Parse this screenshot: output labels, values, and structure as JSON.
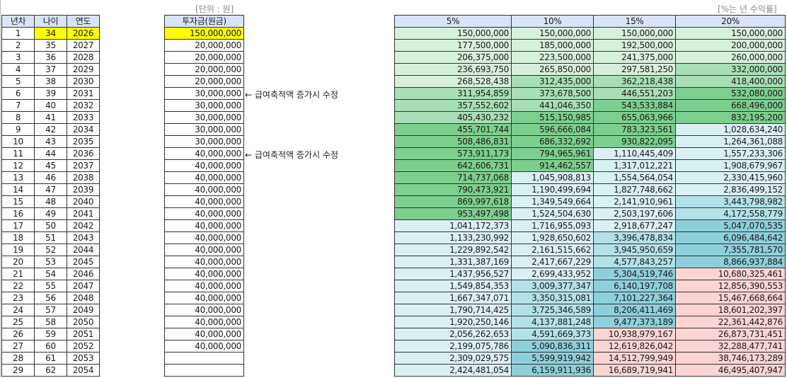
{
  "left_table": {
    "headers": [
      "년차",
      "나이",
      "연도"
    ],
    "ages": [
      "34",
      "35",
      "36",
      "37",
      "38",
      "39",
      "40",
      "41",
      "42",
      "43",
      "44",
      "45",
      "46",
      "47",
      "48",
      "49",
      "50",
      "51",
      "52",
      "53",
      "54",
      "55",
      "56",
      "57",
      "58",
      "59",
      "60",
      "61",
      "62"
    ],
    "years": [
      "2026",
      "2027",
      "2028",
      "2029",
      "2030",
      "2031",
      "2032",
      "2033",
      "2034",
      "2035",
      "2036",
      "2037",
      "2038",
      "2039",
      "2040",
      "2041",
      "2042",
      "2043",
      "2044",
      "2045",
      "2046",
      "2047",
      "2048",
      "2049",
      "2050",
      "2051",
      "2052",
      "2053",
      "2054"
    ]
  },
  "invest_table": {
    "unit_label": "[단위 : 원]",
    "header": "투자금(원금)",
    "values": [
      "150,000,000",
      "20,000,000",
      "20,000,000",
      "20,000,000",
      "20,000,000",
      "30,000,000",
      "30,000,000",
      "30,000,000",
      "30,000,000",
      "30,000,000",
      "40,000,000",
      "40,000,000",
      "40,000,000",
      "40,000,000",
      "40,000,000",
      "40,000,000",
      "40,000,000",
      "40,000,000",
      "40,000,000",
      "40,000,000",
      "40,000,000",
      "40,000,000",
      "40,000,000",
      "40,000,000",
      "40,000,000",
      "40,000,000",
      "40,000,000",
      "",
      ""
    ],
    "notes": [
      {
        "row": 6,
        "text": "← 급여축적액 증가시 수정"
      },
      {
        "row": 11,
        "text": "← 급여축적액 증가시 수정"
      }
    ]
  },
  "return_table": {
    "unit_label": "[%는 년 수익률]",
    "headers": [
      "5%",
      "10%",
      "15%",
      "20%"
    ],
    "rows": [
      [
        "150,000,000",
        "150,000,000",
        "150,000,000",
        "150,000,000"
      ],
      [
        "177,500,000",
        "185,000,000",
        "192,500,000",
        "200,000,000"
      ],
      [
        "206,375,000",
        "223,500,000",
        "241,375,000",
        "260,000,000"
      ],
      [
        "236,693,750",
        "265,850,000",
        "297,581,250",
        "332,000,000"
      ],
      [
        "268,528,438",
        "312,435,000",
        "362,218,438",
        "418,400,000"
      ],
      [
        "311,954,859",
        "373,678,500",
        "446,551,203",
        "532,080,000"
      ],
      [
        "357,552,602",
        "441,046,350",
        "543,533,884",
        "668,496,000"
      ],
      [
        "405,430,232",
        "515,150,985",
        "655,063,966",
        "832,195,200"
      ],
      [
        "455,701,744",
        "596,666,084",
        "783,323,561",
        "1,028,634,240"
      ],
      [
        "508,486,831",
        "686,332,692",
        "930,822,095",
        "1,264,361,088"
      ],
      [
        "573,911,173",
        "794,965,961",
        "1,110,445,409",
        "1,557,233,306"
      ],
      [
        "642,606,731",
        "914,462,557",
        "1,317,012,221",
        "1,908,679,967"
      ],
      [
        "714,737,068",
        "1,045,908,813",
        "1,554,564,054",
        "2,330,415,960"
      ],
      [
        "790,473,921",
        "1,190,499,694",
        "1,827,748,662",
        "2,836,499,152"
      ],
      [
        "869,997,618",
        "1,349,549,664",
        "2,141,910,961",
        "3,443,798,982"
      ],
      [
        "953,497,498",
        "1,524,504,630",
        "2,503,197,606",
        "4,172,558,779"
      ],
      [
        "1,041,172,373",
        "1,716,955,093",
        "2,918,677,247",
        "5,047,070,535"
      ],
      [
        "1,133,230,992",
        "1,928,650,602",
        "3,396,478,834",
        "6,096,484,642"
      ],
      [
        "1,229,892,542",
        "2,161,515,662",
        "3,945,950,659",
        "7,355,781,570"
      ],
      [
        "1,331,387,169",
        "2,417,667,229",
        "4,577,843,257",
        "8,866,937,884"
      ],
      [
        "1,437,956,527",
        "2,699,433,952",
        "5,304,519,746",
        "10,680,325,461"
      ],
      [
        "1,549,854,353",
        "3,009,377,347",
        "6,140,197,708",
        "12,856,390,553"
      ],
      [
        "1,667,347,071",
        "3,350,315,081",
        "7,101,227,364",
        "15,467,668,664"
      ],
      [
        "1,790,714,425",
        "3,725,346,589",
        "8,206,411,469",
        "18,601,202,397"
      ],
      [
        "1,920,250,146",
        "4,137,881,248",
        "9,477,373,189",
        "22,361,442,876"
      ],
      [
        "2,056,262,653",
        "4,591,669,373",
        "10,938,979,167",
        "26,873,731,451"
      ],
      [
        "2,199,075,786",
        "5,090,836,311",
        "12,619,826,042",
        "32,288,477,741"
      ],
      [
        "2,309,029,575",
        "5,599,919,942",
        "14,512,799,949",
        "38,746,173,289"
      ],
      [
        "2,424,481,054",
        "6,159,911,936",
        "16,689,719,941",
        "46,495,407,947"
      ]
    ]
  },
  "colors": {
    "highlight": "#ffff00",
    "header": "#d9e4f8",
    "pink": "#fdd4d4"
  }
}
